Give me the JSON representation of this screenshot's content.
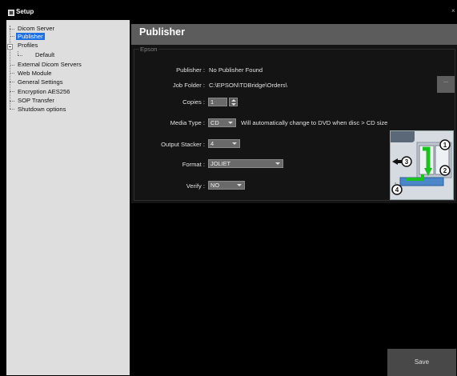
{
  "window": {
    "title": "Setup",
    "close_symbol": "×"
  },
  "sidebar": {
    "items": [
      {
        "label": "Dicom Server",
        "selected": false
      },
      {
        "label": "Publisher",
        "selected": true
      },
      {
        "label": "Profiles",
        "selected": false,
        "expanded": true
      },
      {
        "label": "Default",
        "selected": false
      },
      {
        "label": "External Dicom Servers",
        "selected": false
      },
      {
        "label": "Web Module",
        "selected": false
      },
      {
        "label": "General Settings",
        "selected": false
      },
      {
        "label": "Encryption AES256",
        "selected": false
      },
      {
        "label": "SOP Transfer",
        "selected": false
      },
      {
        "label": "Shutdown options",
        "selected": false
      }
    ]
  },
  "main": {
    "title": "Publisher",
    "group_label": "Epson",
    "fields": {
      "publisher": {
        "label": "Publisher :",
        "value": "No Publisher Found"
      },
      "job_folder": {
        "label": "Job Folder :",
        "value": "C:\\EPSON\\TDBridge\\Orders\\",
        "browse_label": "..."
      },
      "copies": {
        "label": "Copies :",
        "value": "1"
      },
      "media_type": {
        "label": "Media Type :",
        "value": "CD",
        "note": "Will automatically change to DVD when disc > CD size"
      },
      "output_stacker": {
        "label": "Output Stacker :",
        "value": "4"
      },
      "format": {
        "label": "Format :",
        "value": "JOLIET"
      },
      "verify": {
        "label": "Verify :",
        "value": "NO"
      }
    },
    "stacker_graphic": {
      "labels": [
        "1",
        "2",
        "3",
        "4"
      ]
    },
    "save_label": "Save"
  },
  "colors": {
    "selection": "#1e6fe0",
    "header": "#5c5c5c",
    "arrow": "#19c21c"
  }
}
